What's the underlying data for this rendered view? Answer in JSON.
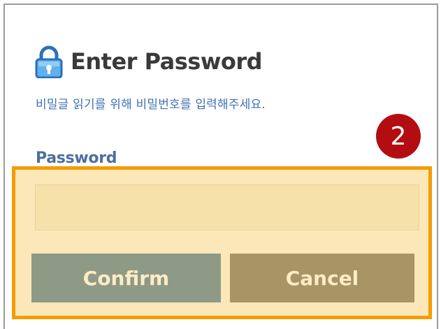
{
  "dialog": {
    "title": "Enter Password",
    "subtitle": "비밀글 읽기를 위해 비밀번호를 입력해주세요.",
    "password_label": "Password",
    "password_value": "",
    "confirm_label": "Confirm",
    "cancel_label": "Cancel"
  },
  "annotation": {
    "step_number": "2",
    "badge_color": "#b30d12",
    "highlight_color": "#f59c00"
  },
  "icons": {
    "title_icon": "lock-icon"
  },
  "colors": {
    "title": "#3a3a3a",
    "subtitle": "#3f72b5",
    "label": "#4d6ea0",
    "confirm_button": "#8f9a86",
    "cancel_button": "#a89464"
  }
}
